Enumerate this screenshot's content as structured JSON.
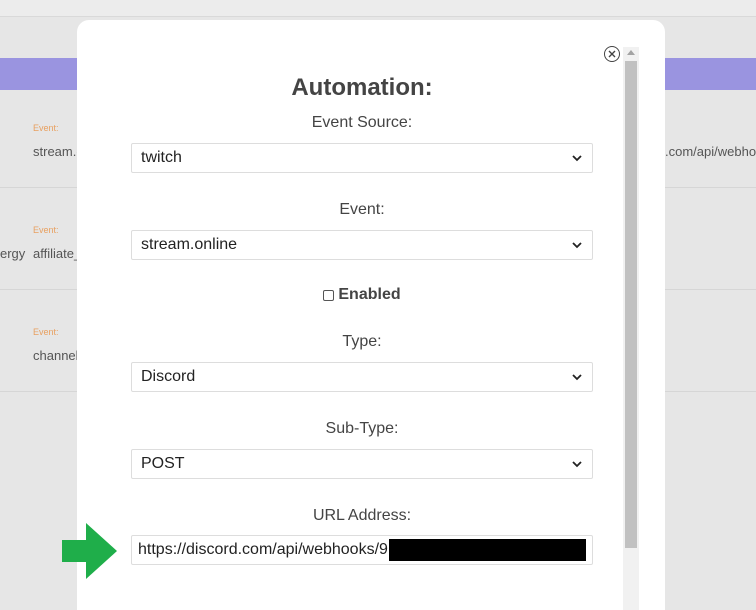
{
  "background": {
    "rows": [
      {
        "event_label": "Event:",
        "value_left": "stream.c",
        "value_right": ".com/api/webhook"
      },
      {
        "event_label": "Event:",
        "value_left": "affiliate_",
        "prefix": "ergy"
      },
      {
        "event_label": "Event:",
        "value_left": "channel"
      }
    ]
  },
  "modal": {
    "title": "Automation:",
    "close_icon": "close-circle-icon",
    "fields": {
      "event_source": {
        "label": "Event Source:",
        "value": "twitch"
      },
      "event": {
        "label": "Event:",
        "value": "stream.online"
      },
      "enabled": {
        "label": "Enabled",
        "checked": false
      },
      "type": {
        "label": "Type:",
        "value": "Discord"
      },
      "sub_type": {
        "label": "Sub-Type:",
        "value": "POST"
      },
      "url": {
        "label": "URL Address:",
        "value": "https://discord.com/api/webhooks/9"
      }
    }
  },
  "colors": {
    "header_band": "#9a94e0",
    "arrow": "#1fae4a",
    "event_label": "#e8a060"
  },
  "annotation": {
    "arrow_icon": "green-arrow-right-icon"
  }
}
